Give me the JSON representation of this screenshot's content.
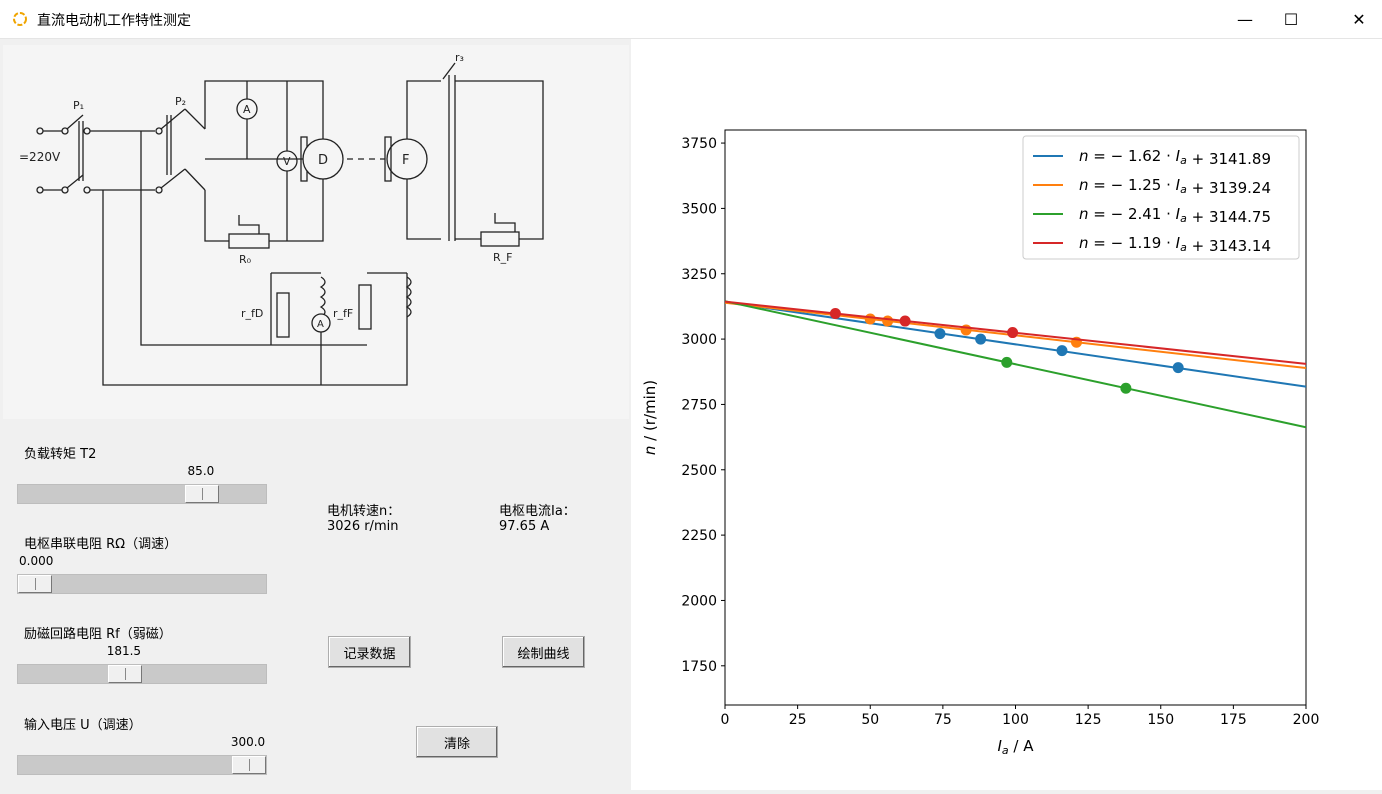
{
  "window": {
    "title": "直流电动机工作特性测定",
    "controls": {
      "minimize": "—",
      "maximize": "☐",
      "close": "✕"
    }
  },
  "circuit": {
    "labels": {
      "p1": "P₁",
      "p2": "P₂",
      "supply": "=220V",
      "ammeter": "A",
      "voltmeter": "V",
      "motor": "D",
      "generator": "F",
      "r0": "R₀",
      "rf": "R_F",
      "r3": "r₃",
      "rfd": "r_fD",
      "rff": "r_fF",
      "ammeter2": "A"
    }
  },
  "controls": {
    "t2": {
      "label": "负载转矩 T2",
      "value": "85.0",
      "fraction": 0.78
    },
    "r_omega": {
      "label": "电枢串联电阻 RΩ（调速）",
      "value": "0.000",
      "fraction": 0.0
    },
    "rf": {
      "label": "励磁回路电阻 Rf（弱磁）",
      "value": "181.5",
      "fraction": 0.42
    },
    "u": {
      "label": "输入电压 U（调速）",
      "value": "300.0",
      "fraction": 1.0
    }
  },
  "readouts": {
    "speed_label": "电机转速n：",
    "speed_value": "3026 r/min",
    "current_label": "电枢电流Ia：",
    "current_value": "97.65 A"
  },
  "buttons": {
    "record": "记录数据",
    "plot": "绘制曲线",
    "clear": "清除"
  },
  "chart_data": {
    "type": "line",
    "xlabel": "I_a / A",
    "ylabel": "n / (r/min)",
    "xlim": [
      0,
      200
    ],
    "ylim": [
      1600,
      3800
    ],
    "xticks": [
      "0",
      "25",
      "50",
      "75",
      "100",
      "125",
      "150",
      "175",
      "200"
    ],
    "yticks": [
      "1750",
      "2000",
      "2250",
      "2500",
      "2750",
      "3000",
      "3250",
      "3500",
      "3750"
    ],
    "legend_position": "top-right",
    "series": [
      {
        "name": "n = − 1.62 · I_a + 3141.89",
        "color": "#1f77b4",
        "slope": -1.62,
        "intercept": 3141.89,
        "points": [
          [
            74,
            3021
          ],
          [
            88,
            3000
          ],
          [
            116,
            2956
          ],
          [
            156,
            2891
          ]
        ]
      },
      {
        "name": "n = − 1.25 · I_a + 3139.24",
        "color": "#ff7f0e",
        "slope": -1.25,
        "intercept": 3139.24,
        "points": [
          [
            50,
            3077
          ],
          [
            56,
            3069
          ],
          [
            83,
            3035
          ],
          [
            121,
            2988
          ]
        ]
      },
      {
        "name": "n = − 2.41 · I_a + 3144.75",
        "color": "#2ca02c",
        "slope": -2.41,
        "intercept": 3144.75,
        "points": [
          [
            97,
            2911
          ],
          [
            138,
            2812
          ]
        ]
      },
      {
        "name": "n = − 1.19 · I_a + 3143.14",
        "color": "#d62728",
        "slope": -1.19,
        "intercept": 3143.14,
        "points": [
          [
            38,
            3098
          ],
          [
            62,
            3069
          ],
          [
            99,
            3025
          ]
        ]
      }
    ]
  }
}
